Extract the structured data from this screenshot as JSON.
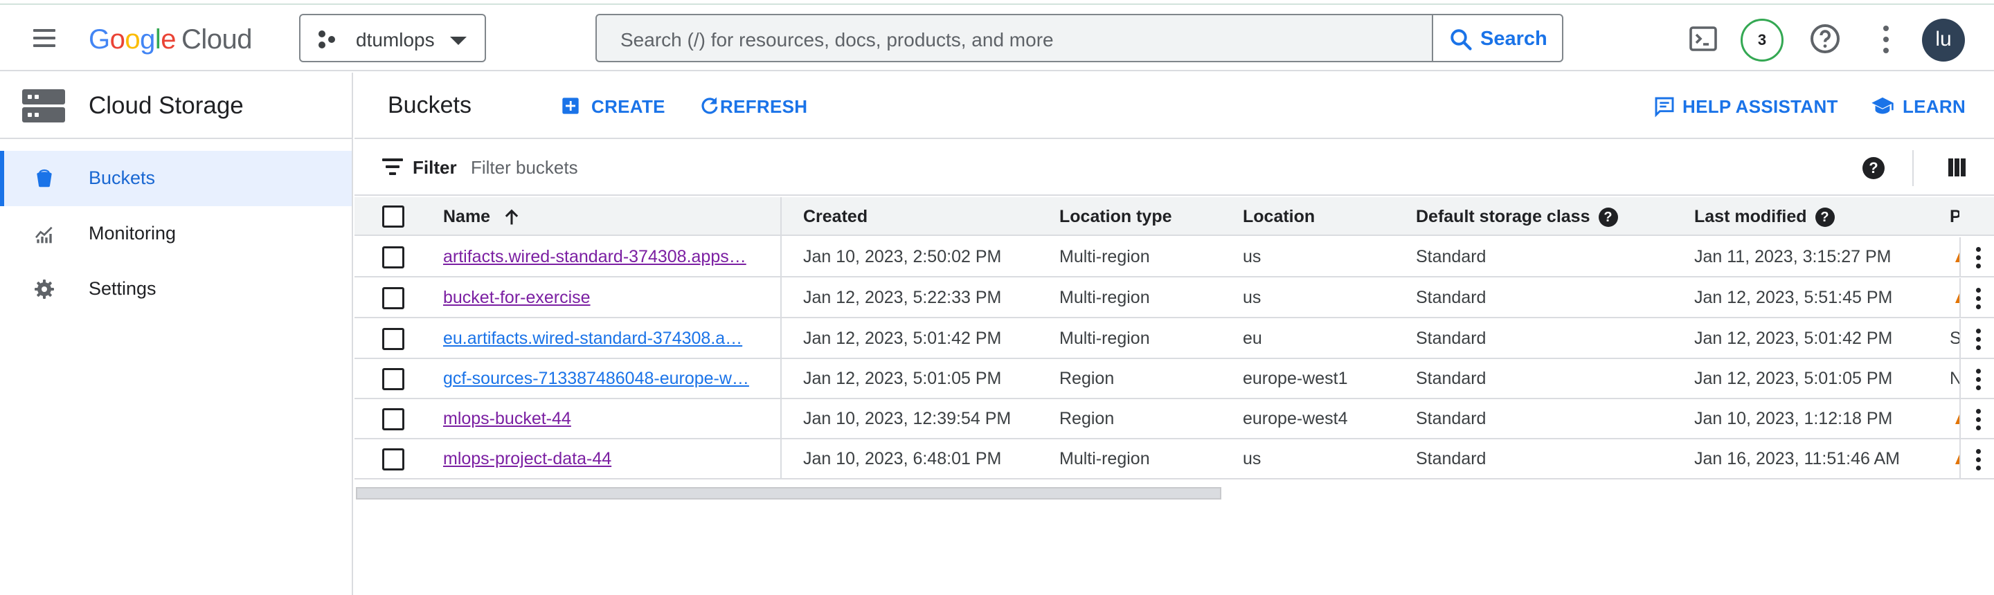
{
  "topbar": {
    "logo_letters": [
      "G",
      "o",
      "o",
      "g",
      "l",
      "e"
    ],
    "logo_product": "Cloud",
    "project_name": "dtumlops",
    "search_placeholder": "Search (/) for resources, docs, products, and more",
    "search_button": "Search",
    "notifications_count": "3",
    "avatar_initials": "lu",
    "icons": [
      "menu-icon",
      "terminal-icon",
      "help-icon",
      "more-vert-icon"
    ]
  },
  "sidebar": {
    "title": "Cloud Storage",
    "items": [
      {
        "label": "Buckets",
        "icon": "bucket-icon",
        "active": true
      },
      {
        "label": "Monitoring",
        "icon": "monitoring-icon",
        "active": false
      },
      {
        "label": "Settings",
        "icon": "gear-icon",
        "active": false
      }
    ]
  },
  "main": {
    "title": "Buckets",
    "actions": {
      "create": "CREATE",
      "refresh": "REFRESH",
      "help_assistant": "HELP ASSISTANT",
      "learn": "LEARN"
    },
    "filter": {
      "label": "Filter",
      "placeholder": "Filter buckets"
    },
    "help_symbol": "?"
  },
  "table": {
    "columns": [
      "Name",
      "Created",
      "Location type",
      "Location",
      "Default storage class",
      "Last modified",
      "P"
    ],
    "sort_column": "Name",
    "sort_direction": "ascending",
    "rows": [
      {
        "name": "artifacts.wired-standard-374308.apps…",
        "created": "Jan 10, 2023, 2:50:02 PM",
        "location_type": "Multi-region",
        "location": "us",
        "storage_class": "Standard",
        "last_modified": "Jan 11, 2023, 3:15:27 PM",
        "p": ""
      },
      {
        "name": "bucket-for-exercise",
        "created": "Jan 12, 2023, 5:22:33 PM",
        "location_type": "Multi-region",
        "location": "us",
        "storage_class": "Standard",
        "last_modified": "Jan 12, 2023, 5:51:45 PM",
        "p": ""
      },
      {
        "name": "eu.artifacts.wired-standard-374308.a…",
        "created": "Jan 12, 2023, 5:01:42 PM",
        "location_type": "Multi-region",
        "location": "eu",
        "storage_class": "Standard",
        "last_modified": "Jan 12, 2023, 5:01:42 PM",
        "p": "S"
      },
      {
        "name": "gcf-sources-713387486048-europe-w…",
        "created": "Jan 12, 2023, 5:01:05 PM",
        "location_type": "Region",
        "location": "europe-west1",
        "storage_class": "Standard",
        "last_modified": "Jan 12, 2023, 5:01:05 PM",
        "p": "N"
      },
      {
        "name": "mlops-bucket-44",
        "created": "Jan 10, 2023, 12:39:54 PM",
        "location_type": "Region",
        "location": "europe-west4",
        "storage_class": "Standard",
        "last_modified": "Jan 10, 2023, 1:12:18 PM",
        "p": ""
      },
      {
        "name": "mlops-project-data-44",
        "created": "Jan 10, 2023, 6:48:01 PM",
        "location_type": "Multi-region",
        "location": "us",
        "storage_class": "Standard",
        "last_modified": "Jan 16, 2023, 11:51:46 AM",
        "p": ""
      }
    ]
  },
  "colors": {
    "accent": "#1a73e8",
    "visited_link": "#7b1fa2",
    "active_nav_bg": "#e8f0fe",
    "warning": "#e37400",
    "notification_ring": "#34a853"
  }
}
